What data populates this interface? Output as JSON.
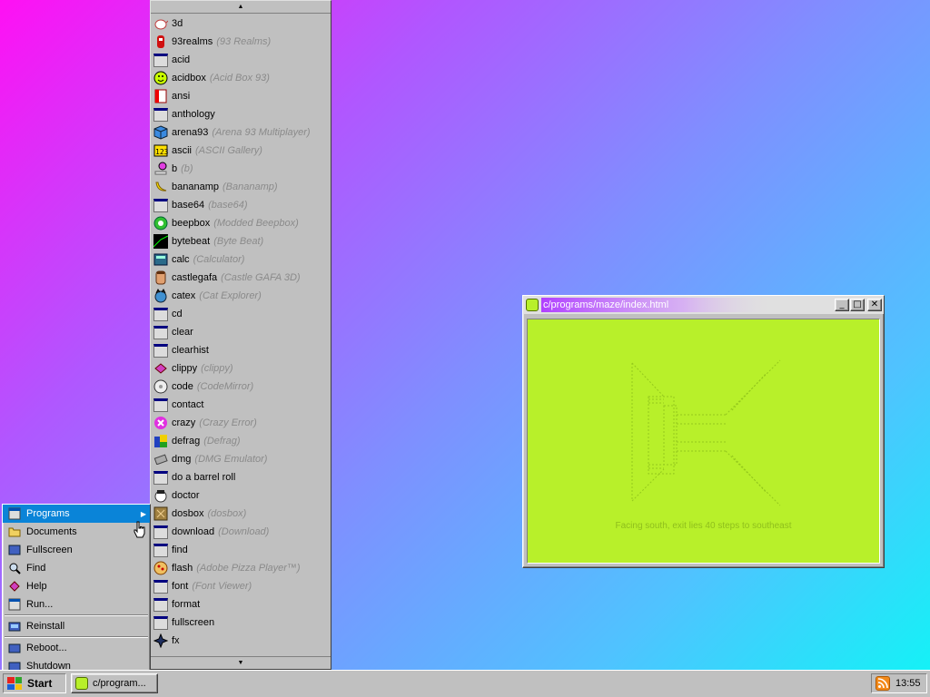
{
  "programs_menu": {
    "scroll_up": "▲",
    "scroll_down": "▼",
    "items": [
      {
        "name": "3d",
        "desc": "",
        "icon": "teapot-icon"
      },
      {
        "name": "93realms",
        "desc": "(93 Realms)",
        "icon": "red-character-icon"
      },
      {
        "name": "acid",
        "desc": "",
        "icon": "app-window-icon"
      },
      {
        "name": "acidbox",
        "desc": "(Acid Box 93)",
        "icon": "smiley-icon"
      },
      {
        "name": "ansi",
        "desc": "",
        "icon": "ansi-book-icon"
      },
      {
        "name": "anthology",
        "desc": "",
        "icon": "app-window-icon"
      },
      {
        "name": "arena93",
        "desc": "(Arena 93 Multiplayer)",
        "icon": "cube-icon"
      },
      {
        "name": "ascii",
        "desc": "(ASCII Gallery)",
        "icon": "ascii-icon"
      },
      {
        "name": "b",
        "desc": "(b)",
        "icon": "b-icon"
      },
      {
        "name": "bananamp",
        "desc": "(Bananamp)",
        "icon": "banana-icon"
      },
      {
        "name": "base64",
        "desc": "(base64)",
        "icon": "app-window-icon"
      },
      {
        "name": "beepbox",
        "desc": "(Modded Beepbox)",
        "icon": "beepbox-icon"
      },
      {
        "name": "bytebeat",
        "desc": "(Byte Beat)",
        "icon": "bytebeat-icon"
      },
      {
        "name": "calc",
        "desc": "(Calculator)",
        "icon": "calculator-icon"
      },
      {
        "name": "castlegafa",
        "desc": "(Castle GAFA 3D)",
        "icon": "face-icon"
      },
      {
        "name": "catex",
        "desc": "(Cat Explorer)",
        "icon": "cat-globe-icon"
      },
      {
        "name": "cd",
        "desc": "",
        "icon": "app-window-icon"
      },
      {
        "name": "clear",
        "desc": "",
        "icon": "app-window-icon"
      },
      {
        "name": "clearhist",
        "desc": "",
        "icon": "app-window-icon"
      },
      {
        "name": "clippy",
        "desc": "(clippy)",
        "icon": "clippy-icon"
      },
      {
        "name": "code",
        "desc": "(CodeMirror)",
        "icon": "code-disk-icon"
      },
      {
        "name": "contact",
        "desc": "",
        "icon": "app-window-icon"
      },
      {
        "name": "crazy",
        "desc": "(Crazy Error)",
        "icon": "error-icon"
      },
      {
        "name": "defrag",
        "desc": "(Defrag)",
        "icon": "defrag-icon"
      },
      {
        "name": "dmg",
        "desc": "(DMG Emulator)",
        "icon": "gameboy-icon"
      },
      {
        "name": "do a barrel roll",
        "desc": "",
        "icon": "app-window-icon"
      },
      {
        "name": "doctor",
        "desc": "",
        "icon": "doctor-icon"
      },
      {
        "name": "dosbox",
        "desc": "(dosbox)",
        "icon": "dosbox-icon"
      },
      {
        "name": "download",
        "desc": "(Download)",
        "icon": "app-window-icon"
      },
      {
        "name": "find",
        "desc": "",
        "icon": "app-window-icon"
      },
      {
        "name": "flash",
        "desc": "(Adobe Pizza Player™)",
        "icon": "pizza-icon"
      },
      {
        "name": "font",
        "desc": "(Font Viewer)",
        "icon": "app-window-icon"
      },
      {
        "name": "format",
        "desc": "",
        "icon": "app-window-icon"
      },
      {
        "name": "fullscreen",
        "desc": "",
        "icon": "app-window-icon"
      },
      {
        "name": "fx",
        "desc": "",
        "icon": "fx-icon"
      }
    ]
  },
  "start_menu": {
    "items": [
      {
        "label": "Programs",
        "icon": "programs-icon",
        "active": true,
        "submenu": true
      },
      {
        "label": "Documents",
        "icon": "folder-icon"
      },
      {
        "label": "Fullscreen",
        "icon": "fullscreen-icon"
      },
      {
        "label": "Find",
        "icon": "find-icon"
      },
      {
        "label": "Help",
        "icon": "help-icon"
      },
      {
        "label": "Run...",
        "icon": "run-icon"
      },
      {
        "label": "Reinstall",
        "icon": "reinstall-icon",
        "separator_before": true
      },
      {
        "label": "Reboot...",
        "icon": "reboot-icon",
        "separator_before": true
      },
      {
        "label": "Shutdown",
        "icon": "shutdown-icon"
      }
    ]
  },
  "maze_window": {
    "title": "c/programs/maze/index.html",
    "minimize": "_",
    "maximize": "□",
    "close": "✕",
    "status": "Facing south, exit lies 40 steps to southeast",
    "bg_color": "#b8f02a"
  },
  "taskbar": {
    "start_label": "Start",
    "task_label": "c/program...",
    "clock": "13:55"
  },
  "colors": {
    "menu_bg": "#c0c0c0",
    "highlight": "#0a84d8",
    "maze_green": "#b8f02a"
  }
}
